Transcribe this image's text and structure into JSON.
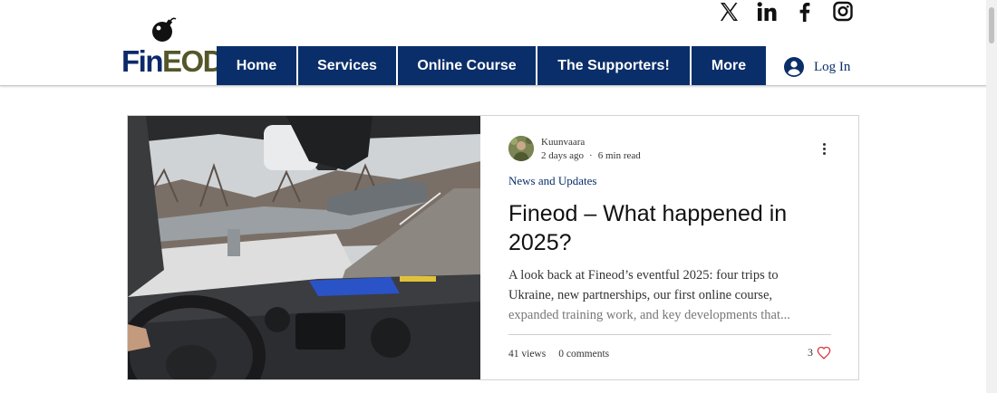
{
  "logo": {
    "text_fin": "Fin",
    "text_eod": "EOD"
  },
  "social": [
    "x-icon",
    "linkedin-icon",
    "facebook-icon",
    "instagram-icon"
  ],
  "nav": {
    "items": [
      {
        "label": "Home"
      },
      {
        "label": "Services"
      },
      {
        "label": "Online Course"
      },
      {
        "label": "The Supporters!"
      },
      {
        "label": "More"
      }
    ],
    "login_label": "Log In"
  },
  "post": {
    "author": "Kuunvaara",
    "posted": "2 days ago",
    "read_time": "6 min read",
    "category": "News and Updates",
    "title": "Fineod – What happened in 2025?",
    "excerpt_main": "A look back at Fineod’s eventful 2025: four trips to Ukraine, new partnerships, our first online course,",
    "excerpt_fade": "expanded training work, and key developments that...",
    "views": "41 views",
    "comments": "0 comments",
    "likes": "3"
  },
  "colors": {
    "nav_bg": "#0a2e69",
    "logo_fin": "#0c2a6b",
    "logo_eod": "#55572a",
    "like_heart": "#d9363e"
  }
}
